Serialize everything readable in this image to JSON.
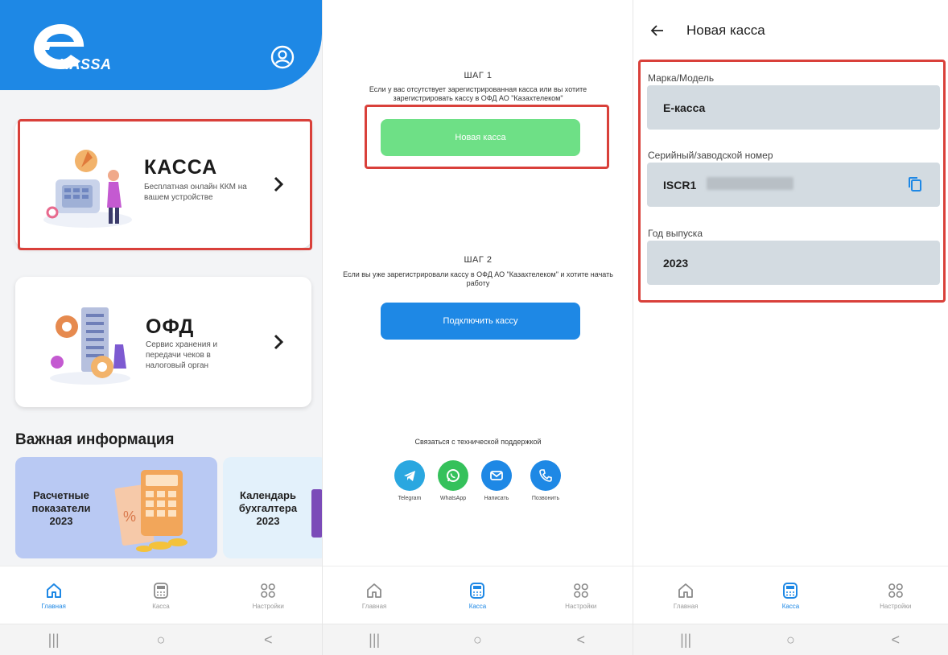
{
  "panel1": {
    "logo_text": "KASSA",
    "card_kassa": {
      "title": "КАССА",
      "desc": "Бесплатная онлайн ККМ на вашем устройстве"
    },
    "card_ofd": {
      "title": "ОФД",
      "desc": "Сервис хранения и передачи чеков в налоговый орган"
    },
    "section_title": "Важная информация",
    "info_cards": [
      {
        "text": "Расчетные показатели 2023"
      },
      {
        "text": "Календарь бухгалтера 2023"
      }
    ],
    "nav": {
      "home": "Главная",
      "kassa": "Касса",
      "settings": "Настройки",
      "active": "home"
    }
  },
  "panel2": {
    "step1_title": "ШАГ 1",
    "step1_desc": "Если у вас отсутствует зарегистрированная касса или вы хотите зарегистрировать кассу в ОФД АО \"Казахтелеком\"",
    "new_kassa_btn": "Новая касса",
    "step2_title": "ШАГ 2",
    "step2_desc": "Если вы уже зарегистрировали кассу в ОФД АО \"Казахтелеком\" и хотите начать работу",
    "connect_btn": "Подключить кассу",
    "support_title": "Связаться с технической поддержкой",
    "support": [
      {
        "label": "Telegram",
        "color": "#2aa7e0"
      },
      {
        "label": "WhatsApp",
        "color": "#35c15b"
      },
      {
        "label": "Написать",
        "color": "#1e88e5"
      },
      {
        "label": "Позвонить",
        "color": "#1e88e5"
      }
    ],
    "nav": {
      "home": "Главная",
      "kassa": "Касса",
      "settings": "Настройки",
      "active": "kassa"
    }
  },
  "panel3": {
    "title": "Новая касса",
    "fields": [
      {
        "label": "Марка/Модель",
        "value": "Е-касса"
      },
      {
        "label": "Серийный/заводской номер",
        "value": "ISCR1"
      },
      {
        "label": "Год выпуска",
        "value": "2023"
      }
    ],
    "nav": {
      "home": "Главная",
      "kassa": "Касса",
      "settings": "Настройки",
      "active": "kassa"
    }
  },
  "system_bar": {
    "recent": "|||",
    "home": "○",
    "back": "<"
  },
  "colors": {
    "accent": "#1e88e5",
    "highlight": "#d9403a",
    "green": "#6ee086"
  }
}
